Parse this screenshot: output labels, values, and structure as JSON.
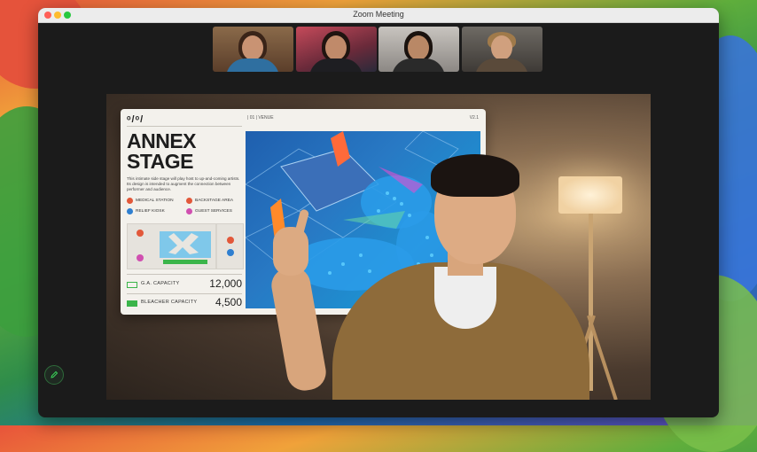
{
  "window": {
    "title": "Zoom Meeting"
  },
  "participants": [
    {
      "name": ""
    },
    {
      "name": ""
    },
    {
      "name": ""
    },
    {
      "name": ""
    }
  ],
  "slide": {
    "logo": "ᵒ/ᵒ/",
    "section": "| 01 | VENUE",
    "code": "V2.1",
    "title_line1": "ANNEX",
    "title_line2": "STAGE",
    "description": "This intimate side stage will play host to up-and-coming artists. Its design is intended to augment the connection between performer and audience.",
    "legend": [
      {
        "label": "MEDICAL STATION",
        "color": "#e2583a"
      },
      {
        "label": "BACKSTAGE AREA",
        "color": "#e2583a"
      },
      {
        "label": "RELIEF KIOSK",
        "color": "#2f7fd0"
      },
      {
        "label": "GUEST SERVICES",
        "color": "#d04fb0"
      }
    ],
    "capacities": [
      {
        "label": "G.A. CAPACITY",
        "value": "12,000"
      },
      {
        "label": "BLEACHER CAPACITY",
        "value": "4,500"
      }
    ]
  },
  "colors": {
    "accent_green": "#3bb54a",
    "map_blue": "#2879c4"
  },
  "icons": {
    "annotate": "pencil-icon"
  }
}
